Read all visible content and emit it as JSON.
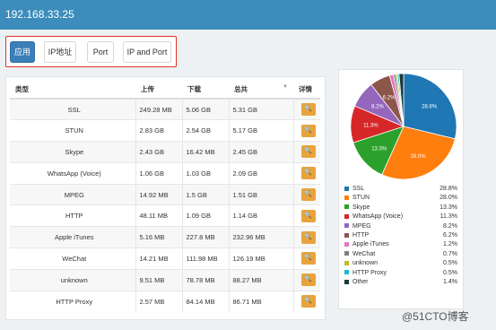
{
  "header": {
    "title": "192.168.33.25"
  },
  "tabs": [
    {
      "label": "应用",
      "active": true
    },
    {
      "label": "IP地址",
      "active": false
    },
    {
      "label": "Port",
      "active": false
    },
    {
      "label": "IP and Port",
      "active": false
    }
  ],
  "table": {
    "columns": [
      "类型",
      "上传",
      "下载",
      "总共",
      "详情"
    ],
    "rows": [
      {
        "type": "SSL",
        "up": "249.28 MB",
        "down": "5.06 GB",
        "total": "5.31 GB"
      },
      {
        "type": "STUN",
        "up": "2.83 GB",
        "down": "2.54 GB",
        "total": "5.17 GB"
      },
      {
        "type": "Skype",
        "up": "2.43 GB",
        "down": "16.42 MB",
        "total": "2.45 GB"
      },
      {
        "type": "WhatsApp (Voice)",
        "up": "1.06 GB",
        "down": "1.03 GB",
        "total": "2.09 GB"
      },
      {
        "type": "MPEG",
        "up": "14.92 MB",
        "down": "1.5 GB",
        "total": "1.51 GB"
      },
      {
        "type": "HTTP",
        "up": "48.11 MB",
        "down": "1.09 GB",
        "total": "1.14 GB"
      },
      {
        "type": "Apple iTunes",
        "up": "5.16 MB",
        "down": "227.8 MB",
        "total": "232.96 MB"
      },
      {
        "type": "WeChat",
        "up": "14.21 MB",
        "down": "111.98 MB",
        "total": "126.19 MB"
      },
      {
        "type": "unknown",
        "up": "9.51 MB",
        "down": "78.78 MB",
        "total": "88.27 MB"
      },
      {
        "type": "HTTP Proxy",
        "up": "2.57 MB",
        "down": "84.14 MB",
        "total": "86.71 MB"
      }
    ]
  },
  "chart_data": {
    "type": "pie",
    "categories": [
      "SSL",
      "STUN",
      "Skype",
      "WhatsApp (Voice)",
      "MPEG",
      "HTTP",
      "Apple iTunes",
      "WeChat",
      "unknown",
      "HTTP Proxy",
      "Other"
    ],
    "values": [
      28.8,
      28.0,
      13.3,
      11.3,
      8.2,
      6.2,
      1.2,
      0.7,
      0.5,
      0.5,
      1.4
    ],
    "labels": [
      "28.8%",
      "28.0%",
      "13.3%",
      "11.3%",
      "8.2%",
      "6.2%",
      "1.2%",
      "0.7%",
      "0.5%",
      "0.5%",
      "1.4%"
    ],
    "slice_labels": [
      "28.8%",
      "28.0%",
      "13.3%",
      "11.3%",
      "8.2%",
      "6.2%",
      "",
      "",
      "",
      "",
      ""
    ],
    "colors": [
      "#1f77b4",
      "#ff7f0e",
      "#2ca02c",
      "#d62728",
      "#9467bd",
      "#8c564b",
      "#e377c2",
      "#7f7f7f",
      "#bcbd22",
      "#17becf",
      "#1a3a3a"
    ],
    "legend_position": "bottom"
  },
  "watermark": "@51CTO博客"
}
